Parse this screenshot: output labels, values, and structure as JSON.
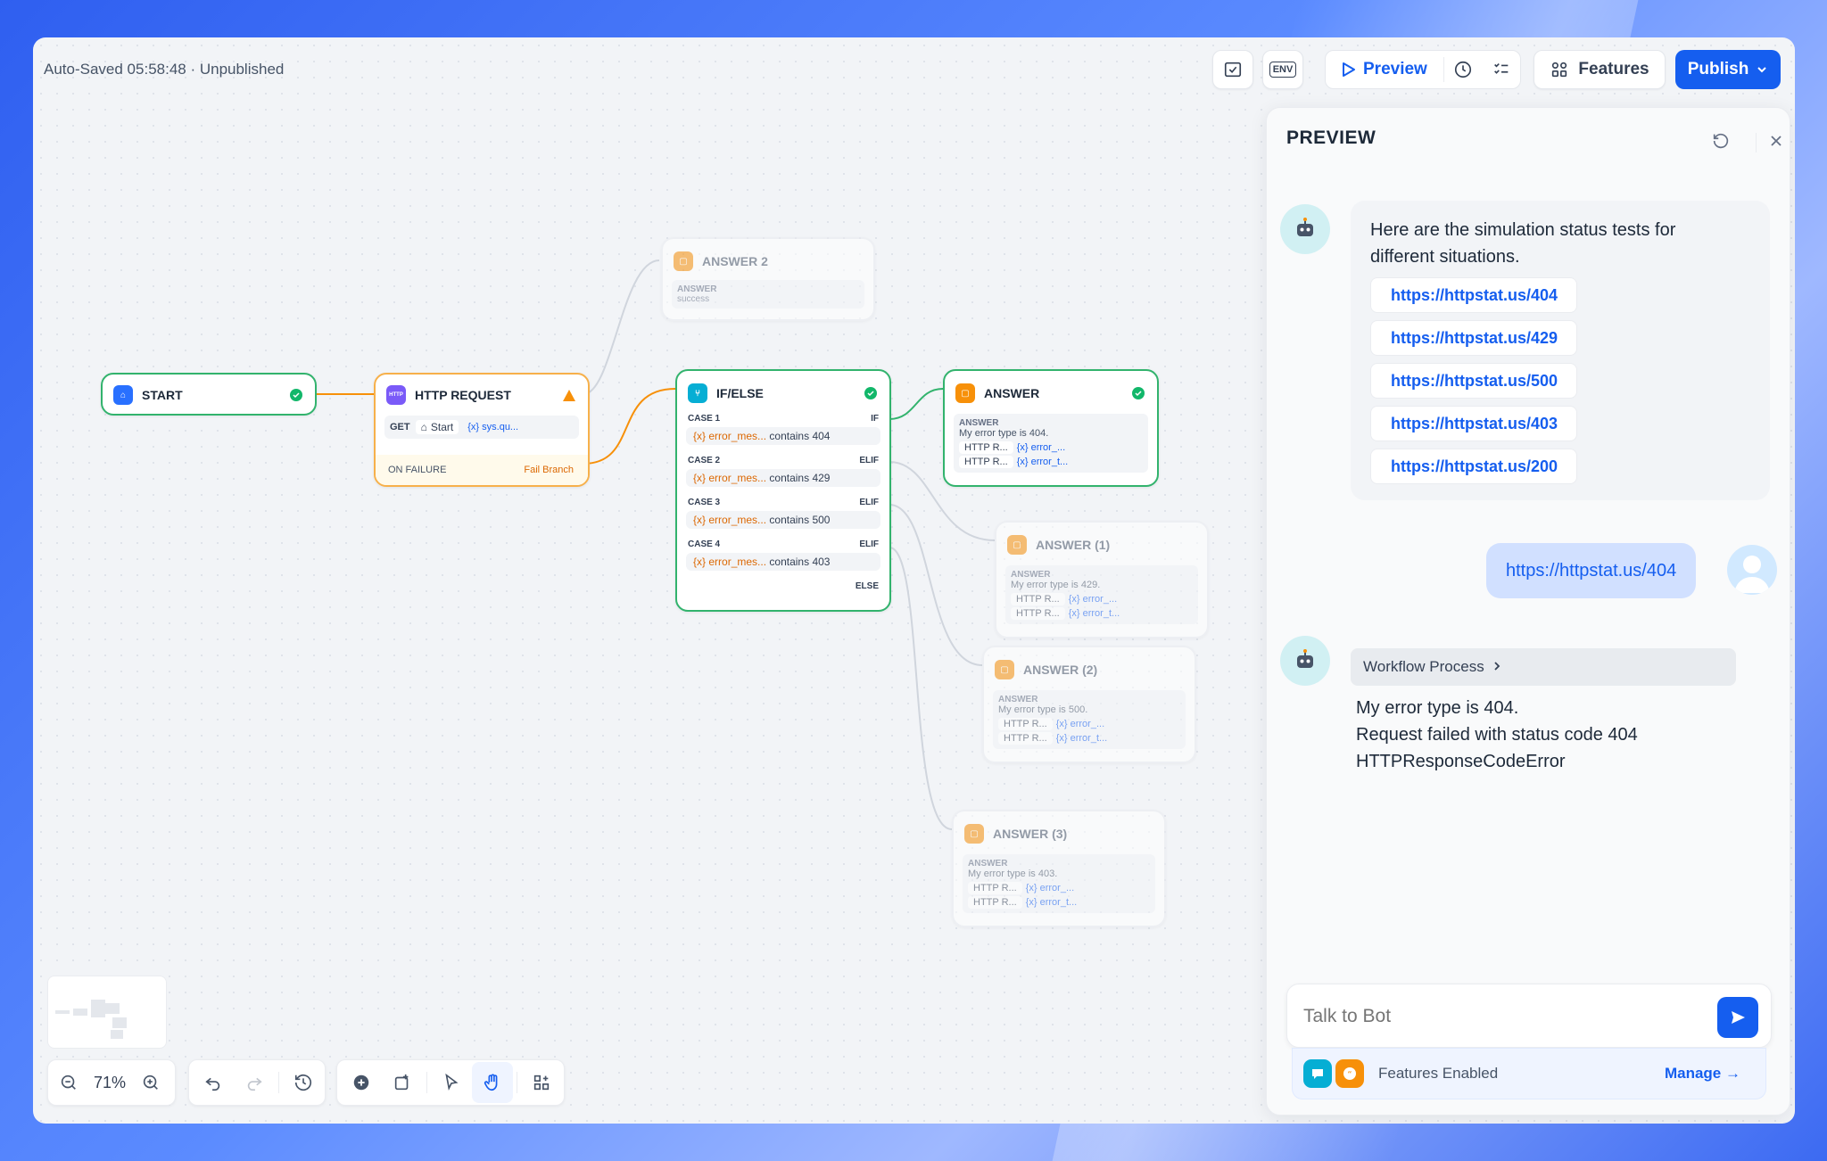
{
  "header": {
    "autosave": "Auto-Saved 05:58:48 · Unpublished",
    "env_label": "ENV",
    "preview_label": "Preview",
    "features_label": "Features",
    "publish_label": "Publish"
  },
  "nodes": {
    "start": {
      "title": "START"
    },
    "http": {
      "title": "HTTP REQUEST",
      "method": "GET",
      "start_tag": "Start",
      "var": "sys.qu...",
      "failure_label": "ON FAILURE",
      "failure_value": "Fail Branch"
    },
    "answer2": {
      "title": "ANSWER 2",
      "label": "ANSWER",
      "value": "success"
    },
    "ifelse": {
      "title": "IF/ELSE",
      "cases": [
        {
          "case": "CASE 1",
          "kw": "IF",
          "var": "error_mes...",
          "op": "contains",
          "val": "404"
        },
        {
          "case": "CASE 2",
          "kw": "ELIF",
          "var": "error_mes...",
          "op": "contains",
          "val": "429"
        },
        {
          "case": "CASE 3",
          "kw": "ELIF",
          "var": "error_mes...",
          "op": "contains",
          "val": "500"
        },
        {
          "case": "CASE 4",
          "kw": "ELIF",
          "var": "error_mes...",
          "op": "contains",
          "val": "403"
        }
      ],
      "else": "ELSE"
    },
    "answer_main": {
      "title": "ANSWER",
      "label": "ANSWER",
      "text": "My error type is 404.",
      "t1": "HTTP R...",
      "v1": "error_...",
      "t2": "HTTP R...",
      "v2": "error_t..."
    },
    "answer_1": {
      "title": "ANSWER (1)",
      "label": "ANSWER",
      "text": "My error type is 429.",
      "t1": "HTTP R...",
      "v1": "error_...",
      "t2": "HTTP R...",
      "v2": "error_t..."
    },
    "answer_2b": {
      "title": "ANSWER (2)",
      "label": "ANSWER",
      "text": "My error type is 500.",
      "t1": "HTTP R...",
      "v1": "error_...",
      "t2": "HTTP R...",
      "v2": "error_t..."
    },
    "answer_3": {
      "title": "ANSWER (3)",
      "label": "ANSWER",
      "text": "My error type is 403.",
      "t1": "HTTP R...",
      "v1": "error_...",
      "t2": "HTTP R...",
      "v2": "error_t..."
    }
  },
  "toolbar": {
    "zoom": "71%"
  },
  "panel": {
    "title": "PREVIEW",
    "bot_msg_1": "Here are the simulation status tests for different situations.",
    "links": [
      "https://httpstat.us/404",
      "https://httpstat.us/429",
      "https://httpstat.us/500",
      "https://httpstat.us/403",
      "https://httpstat.us/200"
    ],
    "user_msg": "https://httpstat.us/404",
    "workflow_process": "Workflow Process",
    "bot_msg_2": [
      "My error type is 404.",
      "Request failed with status code 404",
      "HTTPResponseCodeError"
    ],
    "input_placeholder": "Talk to Bot",
    "features_enabled": "Features Enabled",
    "manage": "Manage"
  }
}
